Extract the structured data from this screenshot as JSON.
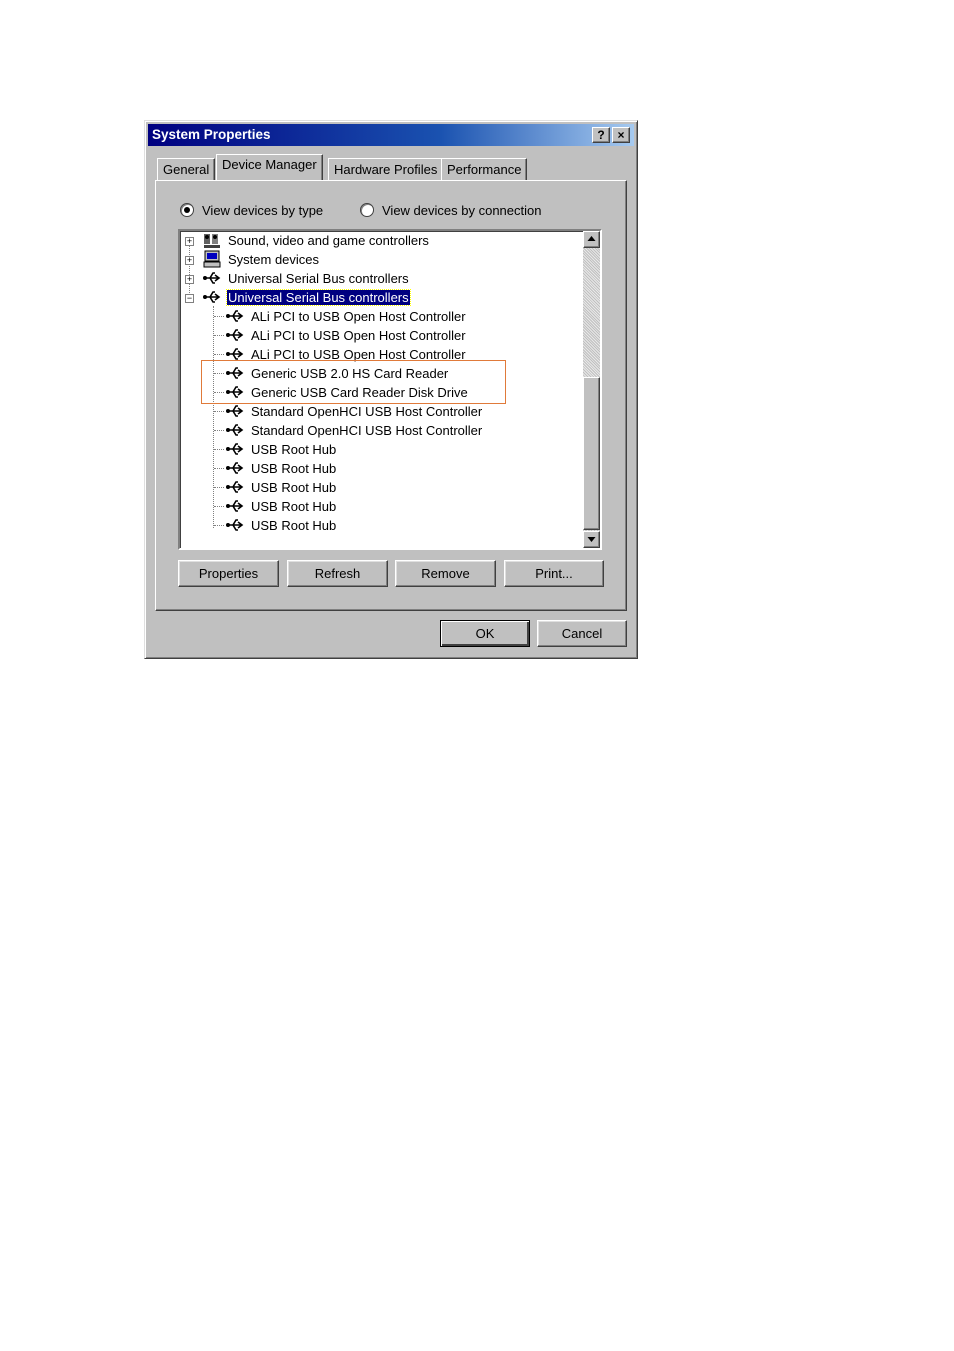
{
  "window": {
    "title": "System Properties",
    "help_label": "?",
    "close_label": "×"
  },
  "tabs": [
    {
      "label": "General",
      "active": false
    },
    {
      "label": "Device Manager",
      "active": true
    },
    {
      "label": "Hardware Profiles",
      "active": false
    },
    {
      "label": "Performance",
      "active": false
    }
  ],
  "view_options": {
    "by_type": {
      "label": "View devices by type",
      "checked": true
    },
    "by_connection": {
      "label": "View devices by connection",
      "checked": false
    }
  },
  "tree": {
    "categories": [
      {
        "label": "Sound, video and game controllers",
        "expanded": false,
        "icon": "speaker-icon"
      },
      {
        "label": "System devices",
        "expanded": false,
        "icon": "computer-icon"
      },
      {
        "label": "Universal Serial Bus controllers",
        "expanded": false,
        "icon": "usb-icon"
      },
      {
        "label": "Universal Serial Bus controllers",
        "expanded": true,
        "selected": true,
        "icon": "usb-icon"
      }
    ],
    "devices": [
      "ALi PCI to USB Open Host Controller",
      "ALi PCI to USB Open Host Controller",
      "ALi PCI to USB Open Host Controller",
      "Generic USB 2.0 HS Card Reader",
      "Generic USB Card Reader Disk Drive",
      "Standard OpenHCI USB Host Controller",
      "Standard OpenHCI USB Host Controller",
      "USB Root Hub",
      "USB Root Hub",
      "USB Root Hub",
      "USB Root Hub",
      "USB Root Hub"
    ],
    "highlighted_devices": [
      "Generic USB 2.0 HS Card Reader",
      "Generic USB Card Reader Disk Drive"
    ]
  },
  "actions": {
    "properties": "Properties",
    "refresh": "Refresh",
    "remove": "Remove",
    "print": "Print..."
  },
  "footer": {
    "ok": "OK",
    "cancel": "Cancel"
  },
  "colors": {
    "title_bar": "#000080",
    "selection": "#000080",
    "highlight_box": "#e07a3a"
  }
}
